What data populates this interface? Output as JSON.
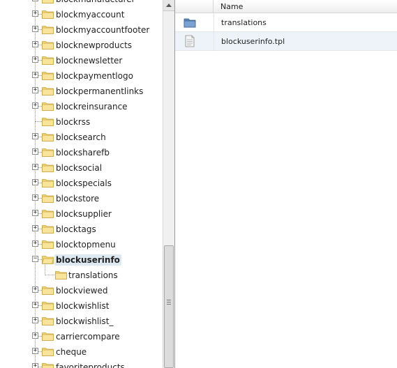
{
  "tree": {
    "items": [
      {
        "label": "blockmanufacturer",
        "expander": "+",
        "selected": false
      },
      {
        "label": "blockmyaccount",
        "expander": "+",
        "selected": false
      },
      {
        "label": "blockmyaccountfooter",
        "expander": "+",
        "selected": false
      },
      {
        "label": "blocknewproducts",
        "expander": "+",
        "selected": false
      },
      {
        "label": "blocknewsletter",
        "expander": "+",
        "selected": false
      },
      {
        "label": "blockpaymentlogo",
        "expander": "+",
        "selected": false
      },
      {
        "label": "blockpermanentlinks",
        "expander": "+",
        "selected": false
      },
      {
        "label": "blockreinsurance",
        "expander": "+",
        "selected": false
      },
      {
        "label": "blockrss",
        "expander": "",
        "selected": false
      },
      {
        "label": "blocksearch",
        "expander": "+",
        "selected": false
      },
      {
        "label": "blocksharefb",
        "expander": "+",
        "selected": false
      },
      {
        "label": "blocksocial",
        "expander": "+",
        "selected": false
      },
      {
        "label": "blockspecials",
        "expander": "+",
        "selected": false
      },
      {
        "label": "blockstore",
        "expander": "+",
        "selected": false
      },
      {
        "label": "blocksupplier",
        "expander": "+",
        "selected": false
      },
      {
        "label": "blocktags",
        "expander": "+",
        "selected": false
      },
      {
        "label": "blocktopmenu",
        "expander": "+",
        "selected": false
      },
      {
        "label": "blockuserinfo",
        "expander": "−",
        "selected": true
      },
      {
        "label": "translations",
        "expander": "",
        "selected": false,
        "child": true
      },
      {
        "label": "blockviewed",
        "expander": "+",
        "selected": false
      },
      {
        "label": "blockwishlist",
        "expander": "+",
        "selected": false
      },
      {
        "label": "blockwishlist_",
        "expander": "+",
        "selected": false
      },
      {
        "label": "carriercompare",
        "expander": "+",
        "selected": false
      },
      {
        "label": "cheque",
        "expander": "+",
        "selected": false
      },
      {
        "label": "favoriteproducts",
        "expander": "+",
        "selected": false
      }
    ]
  },
  "file_list": {
    "header": {
      "name_label": "Name"
    },
    "rows": [
      {
        "name": "translations",
        "icon": "folder-icon"
      },
      {
        "name": "blockuserinfo.tpl",
        "icon": "file-icon"
      }
    ]
  },
  "colors": {
    "selected_bg": "#dde8f0",
    "folder_fill": "#f2d77a",
    "folder_stroke": "#c9a43a",
    "row_alt": "#eef3f9"
  }
}
